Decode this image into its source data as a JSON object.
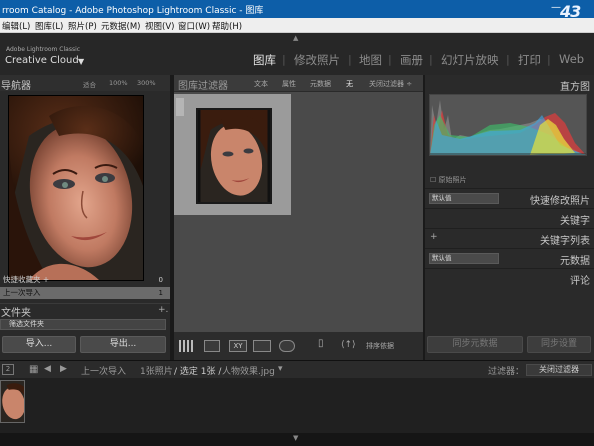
{
  "window": {
    "title": "rroom Catalog - Adobe Photoshop Lightroom Classic - 图库"
  },
  "watermark": {
    "big": "43",
    "small": "433dow"
  },
  "menu": [
    {
      "label": "编辑(L)"
    },
    {
      "label": "图库(L)"
    },
    {
      "label": "照片(P)"
    },
    {
      "label": "元数据(M)"
    },
    {
      "label": "视图(V)"
    },
    {
      "label": "窗口(W)"
    },
    {
      "label": "帮助(H)"
    }
  ],
  "brand": {
    "small": "Adobe Lightroom Classic",
    "large": "Creative Cloud"
  },
  "modules": [
    {
      "label": "图库",
      "active": true
    },
    {
      "label": "修改照片",
      "active": false
    },
    {
      "label": "地图",
      "active": false
    },
    {
      "label": "画册",
      "active": false
    },
    {
      "label": "幻灯片放映",
      "active": false
    },
    {
      "label": "打印",
      "active": false
    },
    {
      "label": "Web",
      "active": false
    }
  ],
  "navigator": {
    "title": "导航器",
    "zoom": [
      "适合",
      "100%",
      "300%"
    ]
  },
  "collections": {
    "quick": {
      "label": "快捷收藏夹",
      "count": "0"
    },
    "previous": {
      "label": "上一次导入",
      "count": "1"
    }
  },
  "folders": {
    "title": "文件夹",
    "search_placeholder": "筛选文件夹"
  },
  "buttons": {
    "import": "导入...",
    "export": "导出...",
    "sync_meta": "同步元数据",
    "sync_settings": "同步设置"
  },
  "filter": {
    "title": "图库过滤器",
    "options": [
      {
        "label": "文本",
        "active": false
      },
      {
        "label": "属性",
        "active": false
      },
      {
        "label": "元数据",
        "active": false
      },
      {
        "label": "无",
        "active": true
      }
    ],
    "preset": "关闭过滤器 ÷"
  },
  "toolbar": {
    "sort_label": "排序依据"
  },
  "right": {
    "histogram": "直方图",
    "original_photo": "原始照片",
    "quick_develop": "快速修改照片",
    "saved_preset": "默认值",
    "keywording": "关键字",
    "keyword_list": "关键字列表",
    "metadata": "元数据",
    "metadata_preset": "默认值",
    "comments": "评论"
  },
  "filmstrip": {
    "page": "2",
    "source": "上一次导入",
    "count_text": "1张照片",
    "selected_text": "/ 选定 1张 /",
    "filename": "人物效果.jpg",
    "filter_label": "过滤器：",
    "filter_value": "关闭过滤器"
  },
  "colors": {
    "titlebar": "#0d5ea8",
    "active_module": "#e6e6e6",
    "inactive_module": "#8c8c8c"
  }
}
